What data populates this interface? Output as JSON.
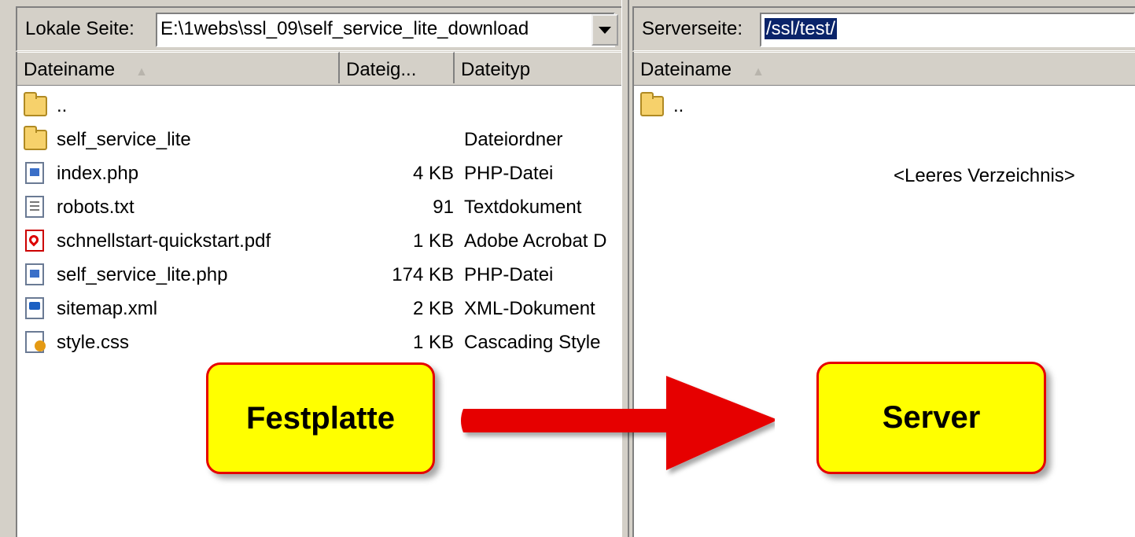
{
  "local": {
    "label": "Lokale Seite:",
    "path": "E:\\1webs\\ssl_09\\self_service_lite_download",
    "columns": {
      "name": "Dateiname",
      "size": "Dateig...",
      "type": "Dateityp"
    },
    "files": [
      {
        "name": "..",
        "size": "",
        "type": "",
        "icon": "folder-icon"
      },
      {
        "name": "self_service_lite",
        "size": "",
        "type": "Dateiordner",
        "icon": "folder-icon"
      },
      {
        "name": "index.php",
        "size": "4 KB",
        "type": "PHP-Datei",
        "icon": "php-file-icon"
      },
      {
        "name": "robots.txt",
        "size": "91",
        "type": "Textdokument",
        "icon": "text-file-icon"
      },
      {
        "name": "schnellstart-quickstart.pdf",
        "size": "1 KB",
        "type": "Adobe Acrobat D",
        "icon": "pdf-file-icon"
      },
      {
        "name": "self_service_lite.php",
        "size": "174 KB",
        "type": "PHP-Datei",
        "icon": "php-file-icon"
      },
      {
        "name": "sitemap.xml",
        "size": "2 KB",
        "type": "XML-Dokument",
        "icon": "xml-file-icon"
      },
      {
        "name": "style.css",
        "size": "1 KB",
        "type": "Cascading Style",
        "icon": "css-file-icon"
      }
    ]
  },
  "remote": {
    "label": "Serverseite:",
    "path": "/ssl/test/",
    "columns": {
      "name": "Dateiname"
    },
    "files": [
      {
        "name": "..",
        "icon": "folder-icon"
      }
    ],
    "empty_text": "<Leeres Verzeichnis>"
  },
  "callouts": {
    "left": "Festplatte",
    "right": "Server"
  },
  "colors": {
    "callout_fill": "#ffff00",
    "callout_border": "#e60000",
    "arrow": "#e60000",
    "selection": "#0a246a"
  }
}
